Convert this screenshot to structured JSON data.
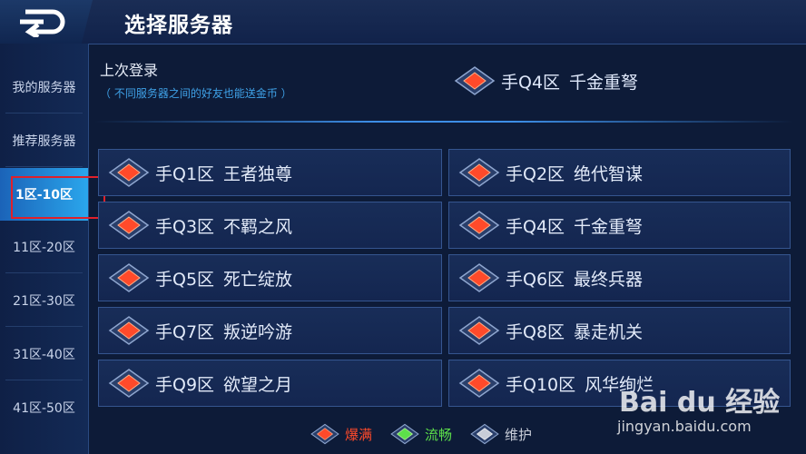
{
  "header": {
    "title": "选择服务器"
  },
  "sidebar": {
    "items": [
      {
        "label": "我的服务器",
        "active": false
      },
      {
        "label": "推荐服务器",
        "active": false
      },
      {
        "label": "1区-10区",
        "active": true
      },
      {
        "label": "11区-20区",
        "active": false
      },
      {
        "label": "21区-30区",
        "active": false
      },
      {
        "label": "31区-40区",
        "active": false
      },
      {
        "label": "41区-50区",
        "active": false
      }
    ]
  },
  "last_login": {
    "title": "上次登录",
    "note": "（ 不同服务器之间的好友也能送金币 ）",
    "server": {
      "zone": "手Q4区",
      "name": "千金重弩",
      "status": "full"
    }
  },
  "servers": [
    {
      "zone": "手Q1区",
      "name": "王者独尊",
      "status": "full"
    },
    {
      "zone": "手Q2区",
      "name": "绝代智谋",
      "status": "full"
    },
    {
      "zone": "手Q3区",
      "name": "不羁之风",
      "status": "full"
    },
    {
      "zone": "手Q4区",
      "name": "千金重弩",
      "status": "full"
    },
    {
      "zone": "手Q5区",
      "name": "死亡绽放",
      "status": "full"
    },
    {
      "zone": "手Q6区",
      "name": "最终兵器",
      "status": "full"
    },
    {
      "zone": "手Q7区",
      "name": "叛逆吟游",
      "status": "full"
    },
    {
      "zone": "手Q8区",
      "name": "暴走机关",
      "status": "full"
    },
    {
      "zone": "手Q9区",
      "name": "欲望之月",
      "status": "full"
    },
    {
      "zone": "手Q10区",
      "name": "风华绚烂",
      "status": "full"
    }
  ],
  "legend": [
    {
      "label": "爆满",
      "color": "#ff4a2a",
      "status": "full"
    },
    {
      "label": "流畅",
      "color": "#5de04a",
      "status": "smooth"
    },
    {
      "label": "维护",
      "color": "#c8cdd8",
      "status": "maintenance"
    }
  ],
  "watermark": {
    "logo": "Bai du 经验",
    "url": "jingyan.baidu.com"
  },
  "colors": {
    "accent": "#2aa6ec",
    "highlight_box": "#e0202a"
  }
}
